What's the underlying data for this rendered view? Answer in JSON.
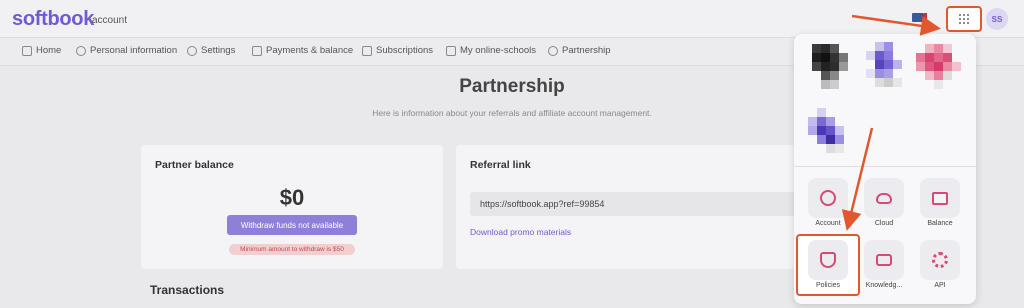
{
  "header": {
    "logo": "softbook",
    "logo_sub": "account",
    "avatar_initials": "SS",
    "apps_icon": "grid-icon"
  },
  "nav": {
    "items": [
      {
        "label": "Home",
        "icon": "home-icon"
      },
      {
        "label": "Personal information",
        "icon": "user-icon"
      },
      {
        "label": "Settings",
        "icon": "gear-icon"
      },
      {
        "label": "Payments & balance",
        "icon": "wallet-icon"
      },
      {
        "label": "Subscriptions",
        "icon": "grid-icon"
      },
      {
        "label": "My online-schools",
        "icon": "graduation-cap-icon"
      },
      {
        "label": "Partnership",
        "icon": "diamond-icon"
      }
    ]
  },
  "page": {
    "title": "Partnership",
    "subtitle": "Here is information about your referrals and affiliate account management."
  },
  "partner_card": {
    "title": "Partner balance",
    "balance": "$0",
    "withdraw_label": "Withdraw funds not available",
    "min_note": "Minimum amount to withdraw is $50"
  },
  "referral_card": {
    "title": "Referral link",
    "link": "https://softbook.app?ref=99854",
    "promo_label": "Download promo materials"
  },
  "transactions": {
    "title": "Transactions"
  },
  "apps_panel": {
    "tiles": [
      {
        "label": "Account",
        "icon": "user-icon"
      },
      {
        "label": "Cloud",
        "icon": "cloud-icon"
      },
      {
        "label": "Balance",
        "icon": "card-icon"
      },
      {
        "label": "Policies",
        "icon": "shield-icon"
      },
      {
        "label": "Knowledg...",
        "icon": "chat-icon"
      },
      {
        "label": "API",
        "icon": "gear-icon"
      }
    ]
  },
  "colors": {
    "brand": "#6e5bd6",
    "accent_pink": "#d84a74",
    "annotation": "#e3572e"
  }
}
